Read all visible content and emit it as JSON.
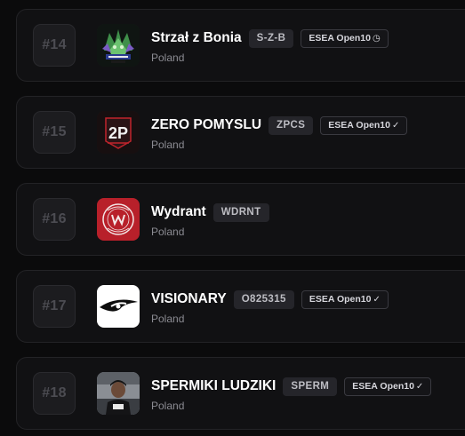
{
  "teams": [
    {
      "rank": "#14",
      "name": "Strzał z Bonia",
      "tag": "S-Z-B",
      "badge": "ESEA Open10",
      "badge_icon": "clock-icon",
      "badge_glyph": "◷",
      "country": "Poland",
      "logo": "strzal-z-bonia-logo"
    },
    {
      "rank": "#15",
      "name": "ZERO POMYSLU",
      "tag": "ZPCS",
      "badge": "ESEA Open10",
      "badge_icon": "checkmark-icon",
      "badge_glyph": "✓",
      "country": "Poland",
      "logo": "zero-pomyslu-logo",
      "logo_text": "2P"
    },
    {
      "rank": "#16",
      "name": "Wydrant",
      "tag": "WDRNT",
      "badge": null,
      "country": "Poland",
      "logo": "wydrant-gaming-logo"
    },
    {
      "rank": "#17",
      "name": "VISIONARY",
      "tag": "O825315",
      "badge": "ESEA Open10",
      "badge_icon": "checkmark-icon",
      "badge_glyph": "✓",
      "country": "Poland",
      "logo": "visionary-eye-logo"
    },
    {
      "rank": "#18",
      "name": "SPERMIKI LUDZIKI",
      "tag": "SPERM",
      "badge": "ESEA Open10",
      "badge_icon": "checkmark-icon",
      "badge_glyph": "✓",
      "country": "Poland",
      "logo": "spermiki-ludziki-photo-logo"
    }
  ],
  "colors": {
    "background": "#0b0b0c",
    "card": "#111113",
    "rank_text": "#4c4c52",
    "wydrant_red": "#b8202a"
  }
}
